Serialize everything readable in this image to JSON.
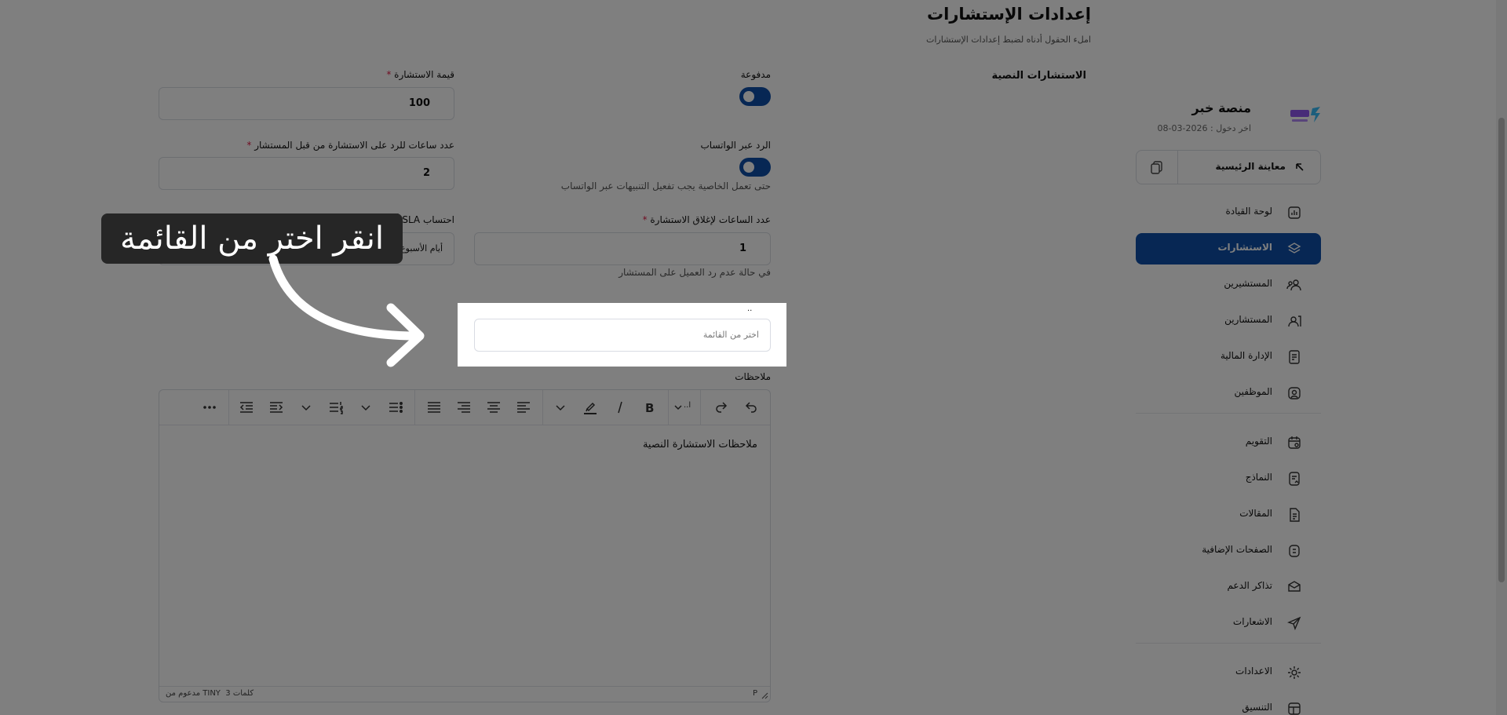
{
  "header": {
    "title": "إعدادات الإستشارات",
    "subtitle": "املء الحقول أدناه لضبط إعدادات الإستشارات",
    "section_title": "الاستشارات النصية"
  },
  "sidebar": {
    "brand_name": "منصة خبر",
    "last_login": "اخر دخول : 2026-03-08",
    "preview_label": "معاينة الرئيسية",
    "items": [
      {
        "label": "لوحة القيادة",
        "icon": "chart-icon"
      },
      {
        "label": "الاستشارات",
        "icon": "layers-icon"
      },
      {
        "label": "المستشيرين",
        "icon": "users-icon"
      },
      {
        "label": "المستشارين",
        "icon": "user-card-icon"
      },
      {
        "label": "الإدارة المالية",
        "icon": "receipt-icon"
      },
      {
        "label": "الموظفين",
        "icon": "user-circle-icon"
      },
      {
        "label": "التقويم",
        "icon": "calendar-icon"
      },
      {
        "label": "النماذج",
        "icon": "form-icon"
      },
      {
        "label": "المقالات",
        "icon": "document-icon"
      },
      {
        "label": "الصفحات الإضافية",
        "icon": "pages-icon"
      },
      {
        "label": "تذاكر الدعم",
        "icon": "ticket-icon"
      },
      {
        "label": "الاشعارات",
        "icon": "send-icon"
      },
      {
        "label": "الاعدادات",
        "icon": "gear-icon"
      },
      {
        "label": "التنسيق",
        "icon": "layout-icon"
      }
    ],
    "active_index": 1
  },
  "form": {
    "paid_label": "مدفوعة",
    "price_label": "قيمة الاستشارة",
    "price_value": "100",
    "whatsapp_label": "الرد عبر الواتساب",
    "whatsapp_hint": "حتى تعمل الخاصية يجب تفعيل التنبيهات عبر الواتساب",
    "response_hours_label": "عدد ساعات للرد على الاستشارة من قبل المستشار",
    "response_hours_value": "2",
    "close_hours_label": "عدد الساعات لإغلاق الاستشارة",
    "close_hours_value": "1",
    "close_hours_hint": "في حالة عدم رد العميل على المستشار",
    "sla_label": "احتساب SLA أيام الإجازات",
    "sla_value": "أيام الأسبوع",
    "list_label": "..",
    "list_placeholder": "اختر من القائمة",
    "notes_label": "ملاحظات",
    "required_mark": "*"
  },
  "editor": {
    "content": "ملاحظات الاستشارة النصية",
    "word_count": "3 كلمات",
    "powered_by": "مدعوم من TINY",
    "path": "P",
    "font_size_label": "..ا"
  },
  "tooltip": {
    "text": "انقر اختر من القائمة"
  },
  "colors": {
    "primary": "#0f4fa8",
    "required": "#e11d48",
    "overlay": "rgba(0,0,0,0.5)"
  }
}
